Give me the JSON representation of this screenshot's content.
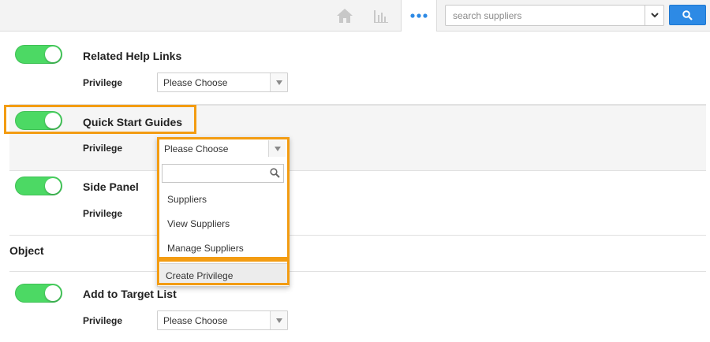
{
  "header": {
    "search": {
      "placeholder": "search suppliers",
      "value": ""
    },
    "icons": {
      "home": "home-icon",
      "chart": "bar-chart-icon",
      "more": "more-dots-icon",
      "dropdown": "chevron-down-icon",
      "search": "search-icon"
    },
    "accent_color": "#2d8ae5"
  },
  "sections": [
    {
      "title": "Related Help Links",
      "privilege_label": "Privilege",
      "privilege_value": "Please Choose",
      "enabled": true
    },
    {
      "title": "Quick Start Guides",
      "privilege_label": "Privilege",
      "privilege_value": "Please Choose",
      "enabled": true
    },
    {
      "title": "Side Panel",
      "privilege_label": "Privilege",
      "privilege_value": "",
      "enabled": true
    }
  ],
  "object_heading": "Object",
  "object_sections": [
    {
      "title": "Add to Target List",
      "privilege_label": "Privilege",
      "privilege_value": "Please Choose",
      "enabled": true
    }
  ],
  "dropdown": {
    "selected": "Please Choose",
    "search_value": "",
    "options": [
      "Suppliers",
      "View Suppliers",
      "Manage Suppliers"
    ],
    "create_label": "Create Privilege"
  },
  "colors": {
    "toggle_on": "#4cd964",
    "highlight": "#f39c12"
  }
}
